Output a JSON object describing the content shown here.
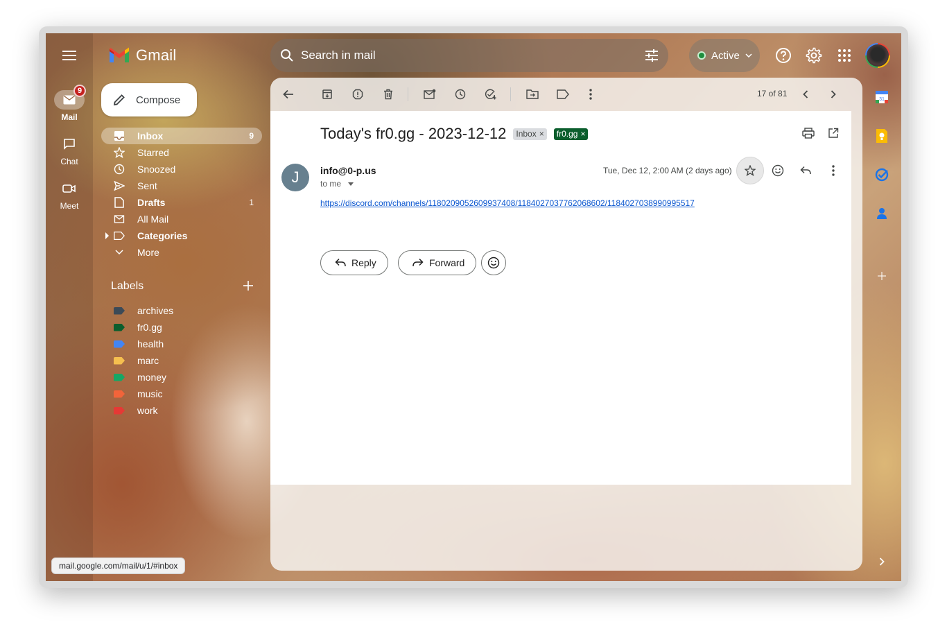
{
  "app": {
    "logo_text": "Gmail"
  },
  "search": {
    "placeholder": "Search in mail"
  },
  "status": {
    "label": "Active"
  },
  "rail": {
    "mail": {
      "label": "Mail",
      "badge": "9"
    },
    "chat": {
      "label": "Chat"
    },
    "meet": {
      "label": "Meet"
    }
  },
  "compose": {
    "label": "Compose"
  },
  "nav": [
    {
      "label": "Inbox",
      "count": "9"
    },
    {
      "label": "Starred"
    },
    {
      "label": "Snoozed"
    },
    {
      "label": "Sent"
    },
    {
      "label": "Drafts",
      "count": "1"
    },
    {
      "label": "All Mail"
    },
    {
      "label": "Categories"
    },
    {
      "label": "More"
    }
  ],
  "labels": {
    "heading": "Labels",
    "items": [
      {
        "name": "archives",
        "color": "#3c4a57"
      },
      {
        "name": "fr0.gg",
        "color": "#0b5e2d"
      },
      {
        "name": "health",
        "color": "#4285f4"
      },
      {
        "name": "marc",
        "color": "#f6bf4f"
      },
      {
        "name": "money",
        "color": "#16a765"
      },
      {
        "name": "music",
        "color": "#f2643a"
      },
      {
        "name": "work",
        "color": "#e53935"
      }
    ]
  },
  "toolbar": {
    "pager": "17 of 81"
  },
  "email": {
    "subject": "Today's fr0.gg - 2023-12-12",
    "chips": {
      "inbox": "Inbox",
      "frog": "fr0.gg",
      "remove": "×"
    },
    "sender_initial": "J",
    "sender": "info@0-p.us",
    "to": "to me",
    "date": "Tue, Dec 12, 2:00 AM (2 days ago)",
    "link": "https://discord.com/channels/1180209052609937408/1184027037762068602/1184027038990995517",
    "reply_label": "Reply",
    "forward_label": "Forward"
  },
  "status_bar": {
    "url": "mail.google.com/mail/u/1/#inbox"
  }
}
